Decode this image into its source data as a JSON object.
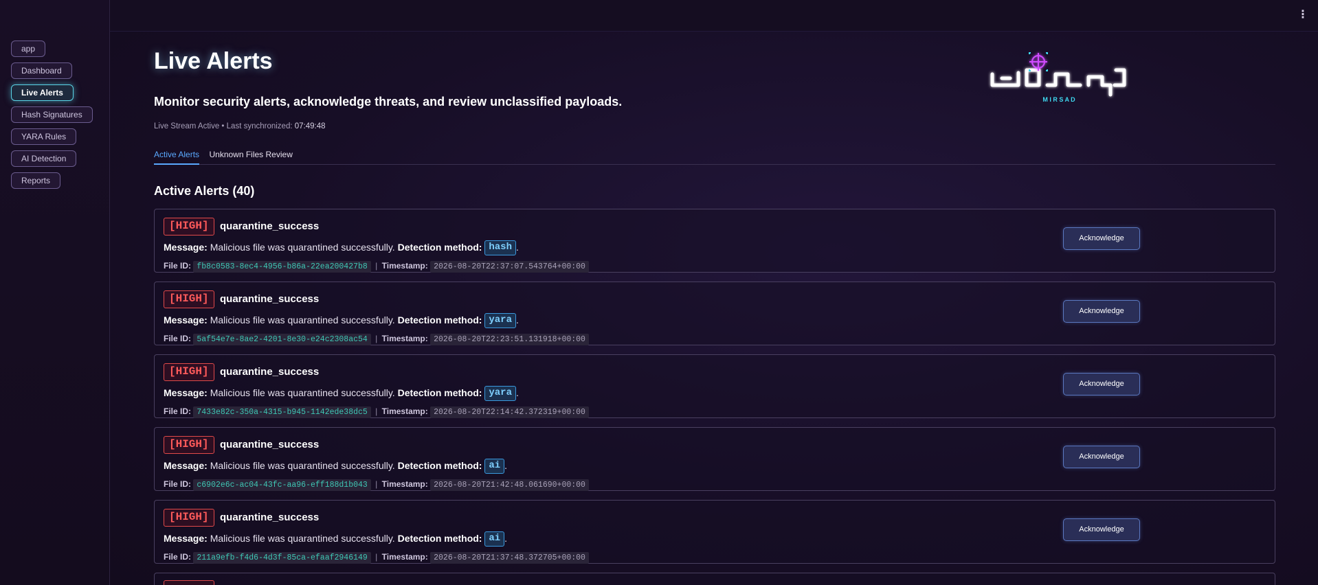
{
  "sidebar": {
    "items": [
      {
        "label": "app",
        "active": false
      },
      {
        "label": "Dashboard",
        "active": false
      },
      {
        "label": "Live Alerts",
        "active": true
      },
      {
        "label": "Hash Signatures",
        "active": false
      },
      {
        "label": "YARA Rules",
        "active": false
      },
      {
        "label": "AI Detection",
        "active": false
      },
      {
        "label": "Reports",
        "active": false
      }
    ]
  },
  "topbar": {
    "menu_icon": "kebab-menu-icon"
  },
  "header": {
    "title": "Live Alerts",
    "subtitle": "Monitor security alerts, acknowledge threats, and review unclassified payloads.",
    "status_text": "Live Stream Active • Last synchronized: ",
    "last_synced": "07:49:48",
    "logo_text": "M I R S A D"
  },
  "tabs": [
    {
      "label": "Active Alerts",
      "active": true
    },
    {
      "label": "Unknown Files Review",
      "active": false
    }
  ],
  "section": {
    "title": "Active Alerts (40)"
  },
  "labels": {
    "message": "Message:",
    "detection_method": "Detection method:",
    "file_id": "File ID:",
    "timestamp": "Timestamp:",
    "separator": "|",
    "acknowledge": "Acknowledge"
  },
  "alerts": [
    {
      "severity": "[HIGH]",
      "event": "quarantine_success",
      "message": "Malicious file was quarantined successfully.",
      "method": "hash",
      "file_id": "fb8c0583-8ec4-4956-b86a-22ea200427b8",
      "timestamp": "2026-08-20T22:37:07.543764+00:00"
    },
    {
      "severity": "[HIGH]",
      "event": "quarantine_success",
      "message": "Malicious file was quarantined successfully.",
      "method": "yara",
      "file_id": "5af54e7e-8ae2-4201-8e30-e24c2308ac54",
      "timestamp": "2026-08-20T22:23:51.131918+00:00"
    },
    {
      "severity": "[HIGH]",
      "event": "quarantine_success",
      "message": "Malicious file was quarantined successfully.",
      "method": "yara",
      "file_id": "7433e82c-350a-4315-b945-1142ede38dc5",
      "timestamp": "2026-08-20T22:14:42.372319+00:00"
    },
    {
      "severity": "[HIGH]",
      "event": "quarantine_success",
      "message": "Malicious file was quarantined successfully.",
      "method": "ai",
      "file_id": "c6902e6c-ac04-43fc-aa96-eff188d1b043",
      "timestamp": "2026-08-20T21:42:48.061690+00:00"
    },
    {
      "severity": "[HIGH]",
      "event": "quarantine_success",
      "message": "Malicious file was quarantined successfully.",
      "method": "ai",
      "file_id": "211a9efb-f4d6-4d3f-85ca-efaaf2946149",
      "timestamp": "2026-08-20T21:37:48.372705+00:00"
    }
  ],
  "colors": {
    "accent": "#5aa9ff",
    "severity_high": "#ff5a5a",
    "file_id": "#3fc7b4",
    "active_nav_glow": "#5ad6e8"
  }
}
